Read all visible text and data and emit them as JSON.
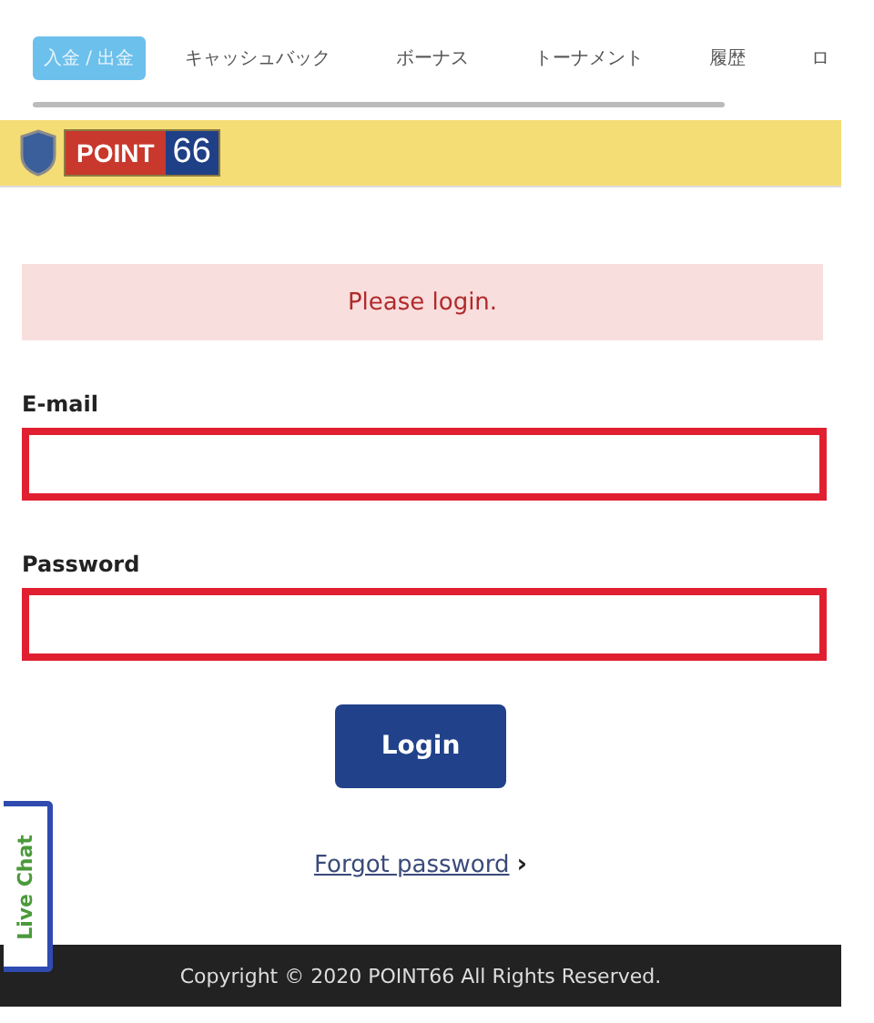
{
  "tabs": [
    {
      "label": "入金 / 出金",
      "selected": true
    },
    {
      "label": "キャッシュバック",
      "selected": false
    },
    {
      "label": "ボーナス",
      "selected": false
    },
    {
      "label": "トーナメント",
      "selected": false
    },
    {
      "label": "履歴",
      "selected": false
    },
    {
      "label": "ロ",
      "selected": false
    }
  ],
  "header": {
    "logo_word": "POINT",
    "logo_number": "66"
  },
  "alert": "Please login.",
  "fields": [
    {
      "label": "E-mail"
    },
    {
      "label": "Password"
    }
  ],
  "login_button": "Login",
  "forgot_link": "Forgot password",
  "forgot_arrow": "›",
  "live_chat": "Live Chat",
  "footer": "Copyright © 2020 POINT66 All Rights Reserved."
}
